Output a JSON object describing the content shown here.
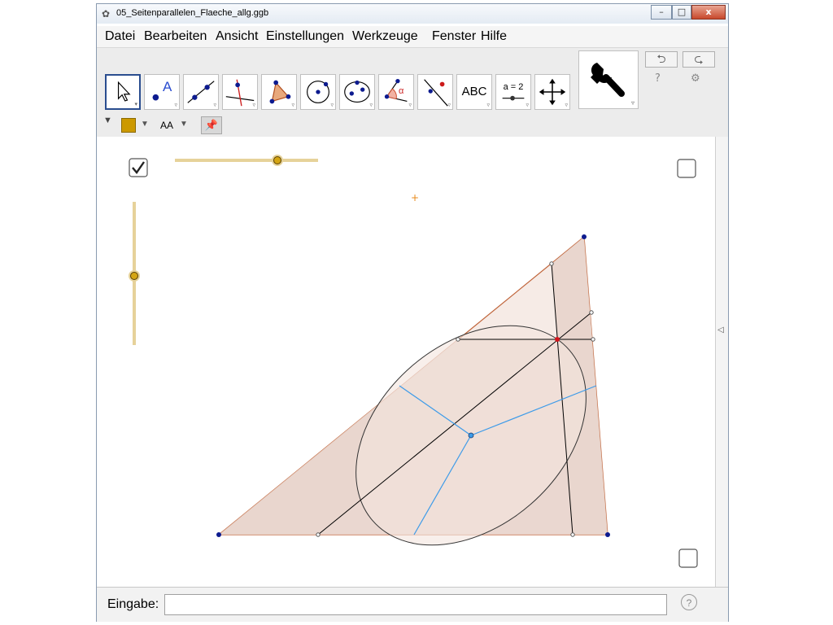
{
  "window": {
    "title": "05_Seitenparallelen_Flaeche_allg.ggb",
    "minimize_glyph": "–",
    "maximize_glyph": "□",
    "close_glyph": "x"
  },
  "menu": [
    {
      "label": "Datei"
    },
    {
      "label": "Bearbeiten"
    },
    {
      "label": "Ansicht"
    },
    {
      "label": "Einstellungen"
    },
    {
      "label": "Werkzeuge"
    },
    {
      "label": "Fenster"
    },
    {
      "label": "Hilfe"
    }
  ],
  "toolbar": {
    "tools": [
      {
        "name": "move",
        "icon": "arrow-pointer-icon"
      },
      {
        "name": "point",
        "icon": "point-icon",
        "text": "A"
      },
      {
        "name": "line",
        "icon": "line-through-points-icon"
      },
      {
        "name": "perpendicular",
        "icon": "perpendicular-line-icon"
      },
      {
        "name": "polygon",
        "icon": "polygon-icon"
      },
      {
        "name": "circle",
        "icon": "circle-center-point-icon"
      },
      {
        "name": "conic",
        "icon": "ellipse-icon"
      },
      {
        "name": "angle",
        "icon": "angle-icon",
        "text": "α"
      },
      {
        "name": "reflect",
        "icon": "reflect-icon"
      },
      {
        "name": "text",
        "icon": "text-icon",
        "text": "ABC"
      },
      {
        "name": "slider",
        "icon": "slider-icon",
        "text": "a = 2"
      },
      {
        "name": "move-view",
        "icon": "move-graphics-view-icon"
      }
    ],
    "big_tool_icon": "wrench-icon",
    "undo_glyph": "⮌",
    "redo_glyph": "⮎",
    "help_glyph": "?",
    "settings_glyph": "⚙"
  },
  "stylebar": {
    "color": "#cc9900",
    "text_size_label": "AA"
  },
  "canvas": {
    "checkbox_left_checked": true,
    "checkbox_right_top_checked": false,
    "checkbox_right_bottom_checked": false,
    "slider_color": "#e6d29a",
    "slider_knob_color": "#d4a514",
    "triangle_fill": "#e8d4cb",
    "triangle_stroke": "#c0653b",
    "blue_line": "#3d9be9",
    "point_color": "#0d1b8f",
    "highlight_point": "#d4141c",
    "cross_marker_color": "#e88a1a"
  },
  "input": {
    "label": "Eingabe:",
    "value": "",
    "help_glyph": "?"
  }
}
